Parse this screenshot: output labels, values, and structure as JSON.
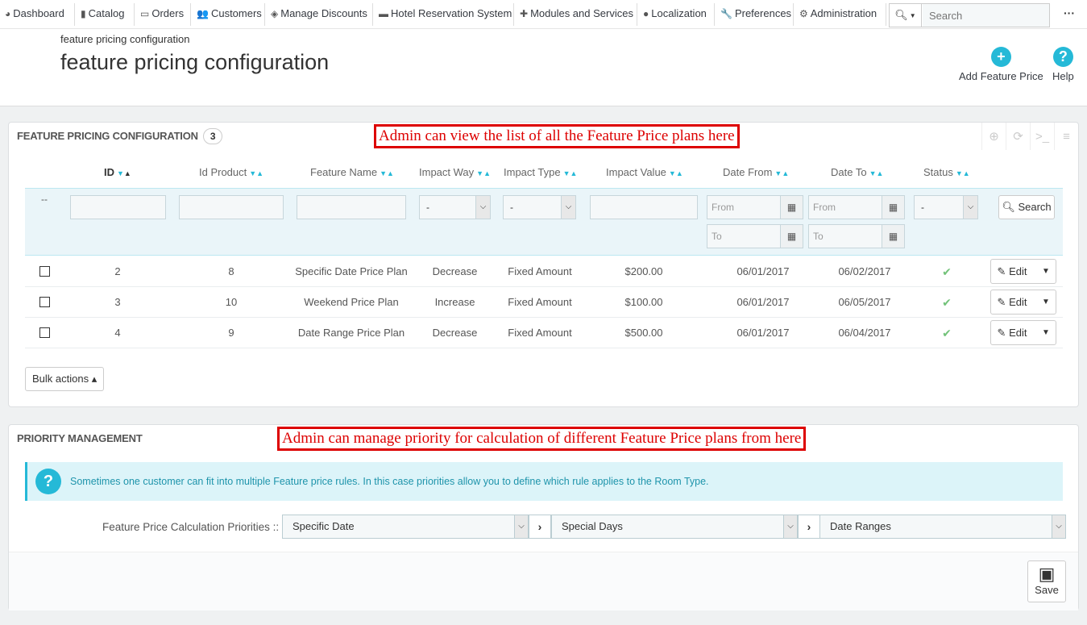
{
  "nav": {
    "items": [
      {
        "label": "Dashboard",
        "icon": "dashboard-icon",
        "glyph": "◕"
      },
      {
        "label": "Catalog",
        "icon": "book-icon",
        "glyph": "▮"
      },
      {
        "label": "Orders",
        "icon": "credit-card-icon",
        "glyph": "▭"
      },
      {
        "label": "Customers",
        "icon": "users-icon",
        "glyph": "👥"
      },
      {
        "label": "Manage Discounts",
        "icon": "tags-icon",
        "glyph": "◈"
      },
      {
        "label": "Hotel Reservation System",
        "icon": "bed-icon",
        "glyph": "▬"
      },
      {
        "label": "Modules and Services",
        "icon": "puzzle-icon",
        "glyph": "✚"
      },
      {
        "label": "Localization",
        "icon": "globe-icon",
        "glyph": "●"
      },
      {
        "label": "Preferences",
        "icon": "wrench-icon",
        "glyph": "🔧"
      },
      {
        "label": "Administration",
        "icon": "cog-icon",
        "glyph": "⚙"
      }
    ],
    "search_placeholder": "Search",
    "more": "···"
  },
  "header": {
    "breadcrumb": "feature pricing configuration",
    "title": "feature pricing configuration",
    "add_button": "Add Feature Price",
    "help_button": "Help"
  },
  "list_panel": {
    "title": "FEATURE PRICING CONFIGURATION",
    "count": "3",
    "annotation": "Admin can view the list of all the Feature Price plans here",
    "columns": [
      "ID",
      "Id Product",
      "Feature Name",
      "Impact Way",
      "Impact Type",
      "Impact Value",
      "Date From",
      "Date To",
      "Status"
    ],
    "filters": {
      "dash": "--",
      "impact_way": "-",
      "impact_type": "-",
      "status": "-",
      "from_placeholder": "From",
      "to_placeholder": "To",
      "search_button": "Search"
    },
    "rows": [
      {
        "id": "2",
        "id_product": "8",
        "feature_name": "Specific Date Price Plan",
        "impact_way": "Decrease",
        "impact_type": "Fixed Amount",
        "impact_value": "$200.00",
        "date_from": "06/01/2017",
        "date_to": "06/02/2017",
        "status": "✔",
        "edit": "Edit"
      },
      {
        "id": "3",
        "id_product": "10",
        "feature_name": "Weekend Price Plan",
        "impact_way": "Increase",
        "impact_type": "Fixed Amount",
        "impact_value": "$100.00",
        "date_from": "06/01/2017",
        "date_to": "06/05/2017",
        "status": "✔",
        "edit": "Edit"
      },
      {
        "id": "4",
        "id_product": "9",
        "feature_name": "Date Range Price Plan",
        "impact_way": "Decrease",
        "impact_type": "Fixed Amount",
        "impact_value": "$500.00",
        "date_from": "06/01/2017",
        "date_to": "06/04/2017",
        "status": "✔",
        "edit": "Edit"
      }
    ],
    "bulk_actions": "Bulk actions ▴"
  },
  "priority_panel": {
    "title": "PRIORITY MANAGEMENT",
    "annotation": "Admin can manage priority for calculation of different Feature Price plans from here",
    "info": "Sometimes one customer can fit into multiple Feature price rules. In this case priorities allow you to define which rule applies to the Room Type.",
    "label": "Feature Price Calculation Priorities ::",
    "selects": [
      "Specific Date",
      "Special Days",
      "Date Ranges"
    ],
    "save": "Save"
  },
  "colors": {
    "accent": "#25b9d7",
    "annotation": "#dd0000",
    "success": "#72c279"
  }
}
